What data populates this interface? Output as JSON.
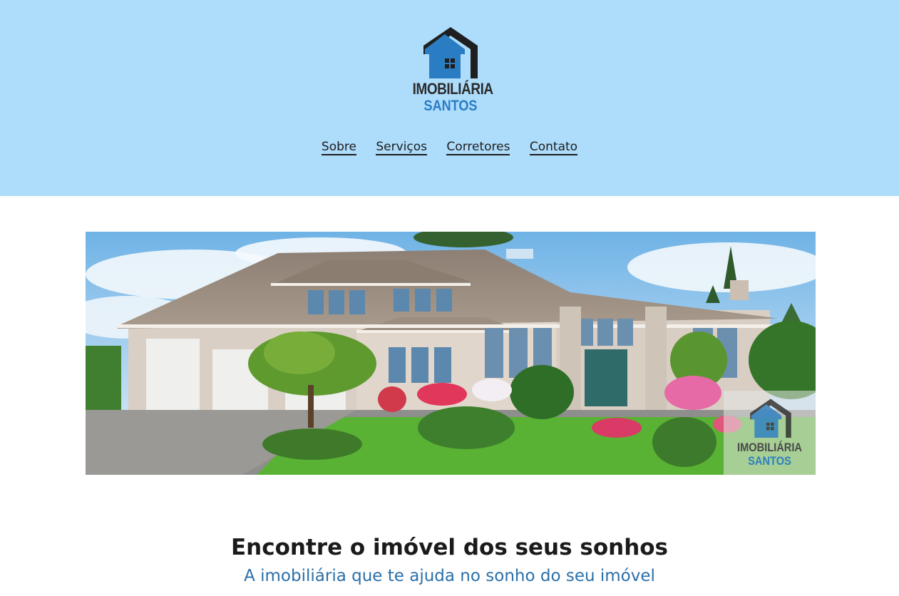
{
  "brand": {
    "line1": "IMOBILIÁRIA",
    "line2": "SANTOS",
    "icon": "house-logo-icon",
    "colors": {
      "dark": "#1f1f1f",
      "blue": "#2a7dc3"
    }
  },
  "nav": {
    "items": [
      {
        "label": "Sobre"
      },
      {
        "label": "Serviços"
      },
      {
        "label": "Corretores"
      },
      {
        "label": "Contato"
      }
    ]
  },
  "hero": {
    "image": "house-photo",
    "watermark": {
      "line1": "IMOBILIÁRIA",
      "line2": "SANTOS"
    }
  },
  "content": {
    "headline": "Encontre o imóvel dos seus sonhos",
    "subheadline": "A imobiliária que te ajuda no sonho do seu imóvel"
  },
  "theme": {
    "header_bg": "#aedcfb",
    "accent": "#2b6fa8"
  }
}
